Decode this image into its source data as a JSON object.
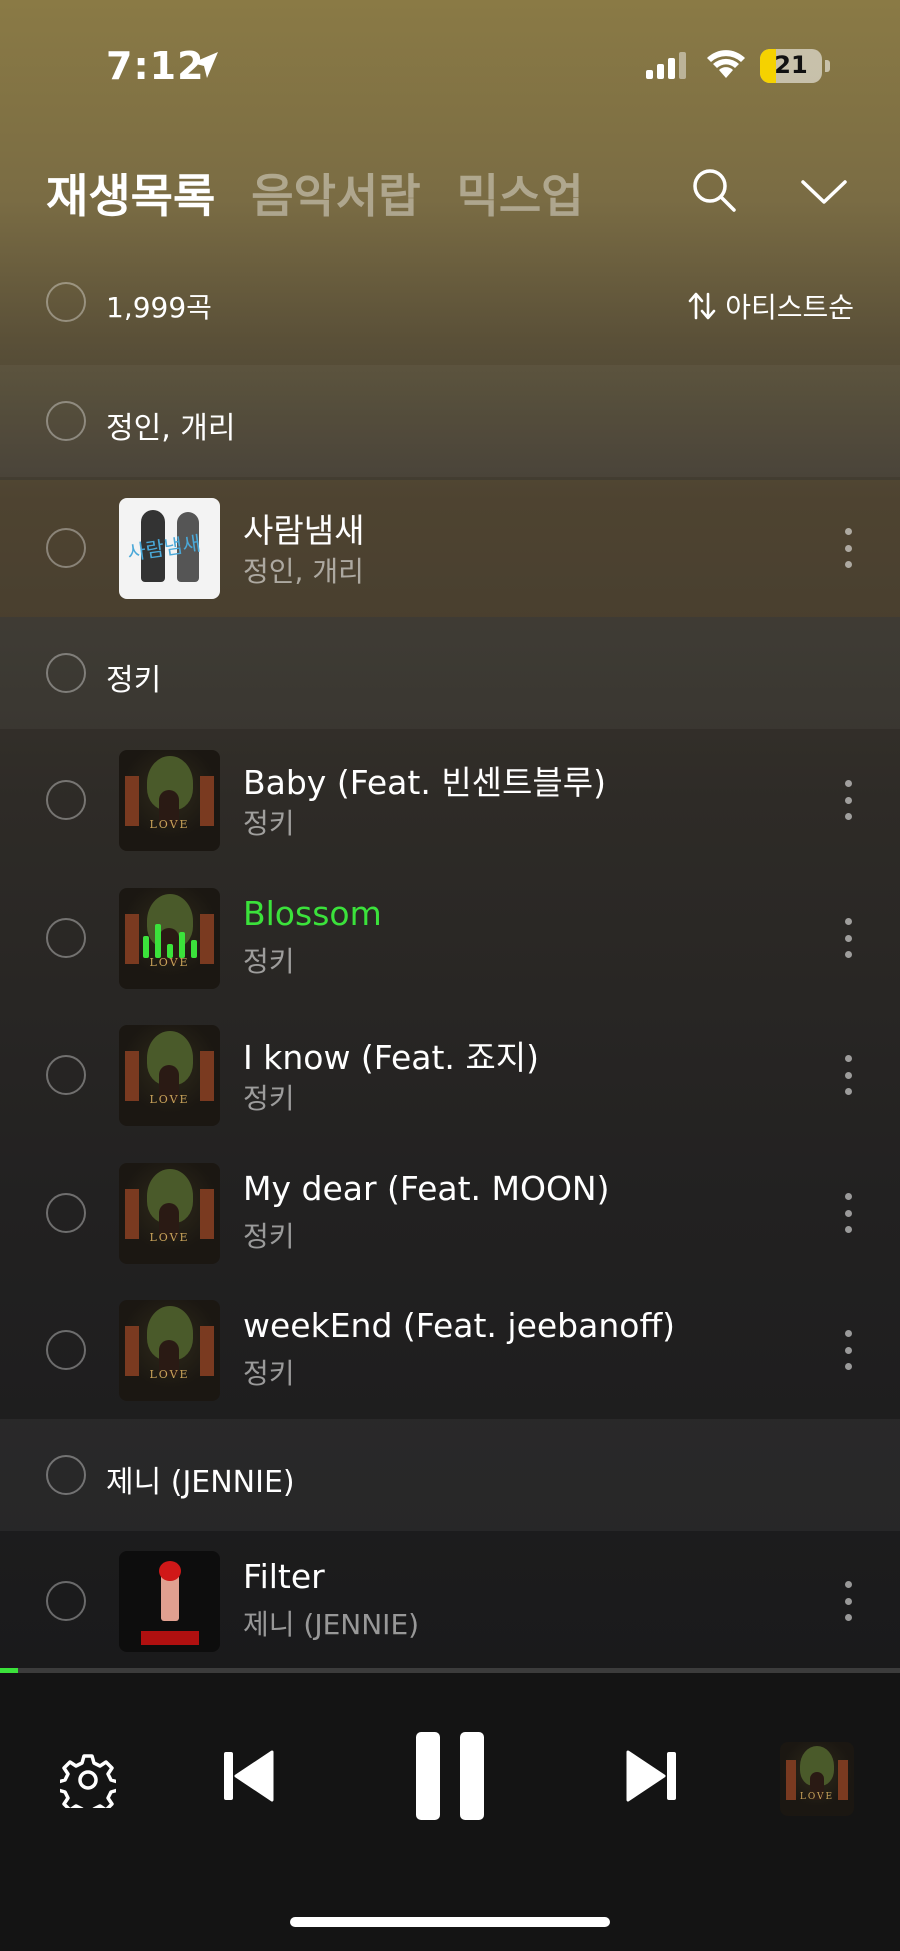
{
  "status_bar": {
    "time": "7:12",
    "battery": "21"
  },
  "header": {
    "tabs": [
      {
        "label": "재생목록",
        "active": true
      },
      {
        "label": "음악서랍",
        "active": false
      },
      {
        "label": "믹스업",
        "active": false
      }
    ],
    "icons": [
      "search-icon",
      "chevron-down-icon"
    ]
  },
  "summary": {
    "count": "1,999곡",
    "sort_label": "아티스트순"
  },
  "groups": [
    {
      "name": "정인, 개리",
      "tracks": [
        {
          "title": "사람냄새",
          "artist": "정인, 개리",
          "art": "white"
        }
      ]
    },
    {
      "name": "정키",
      "tracks": [
        {
          "title": "Baby (Feat. 빈센트블루)",
          "artist": "정키",
          "art": "love"
        },
        {
          "title": "Blossom",
          "artist": "정키",
          "art": "love",
          "playing": true
        },
        {
          "title": "I know (Feat. 죠지)",
          "artist": "정키",
          "art": "love"
        },
        {
          "title": "My dear (Feat. MOON)",
          "artist": "정키",
          "art": "love"
        },
        {
          "title": "weekEnd (Feat. jeebanoff)",
          "artist": "정키",
          "art": "love"
        }
      ]
    },
    {
      "name": "제니 (JENNIE)",
      "tracks": [
        {
          "title": "Filter",
          "artist": "제니 (JENNIE)",
          "art": "red"
        }
      ]
    }
  ],
  "player": {
    "progress": 0.02,
    "state": "playing"
  },
  "colors": {
    "accent": "#3be23b"
  }
}
